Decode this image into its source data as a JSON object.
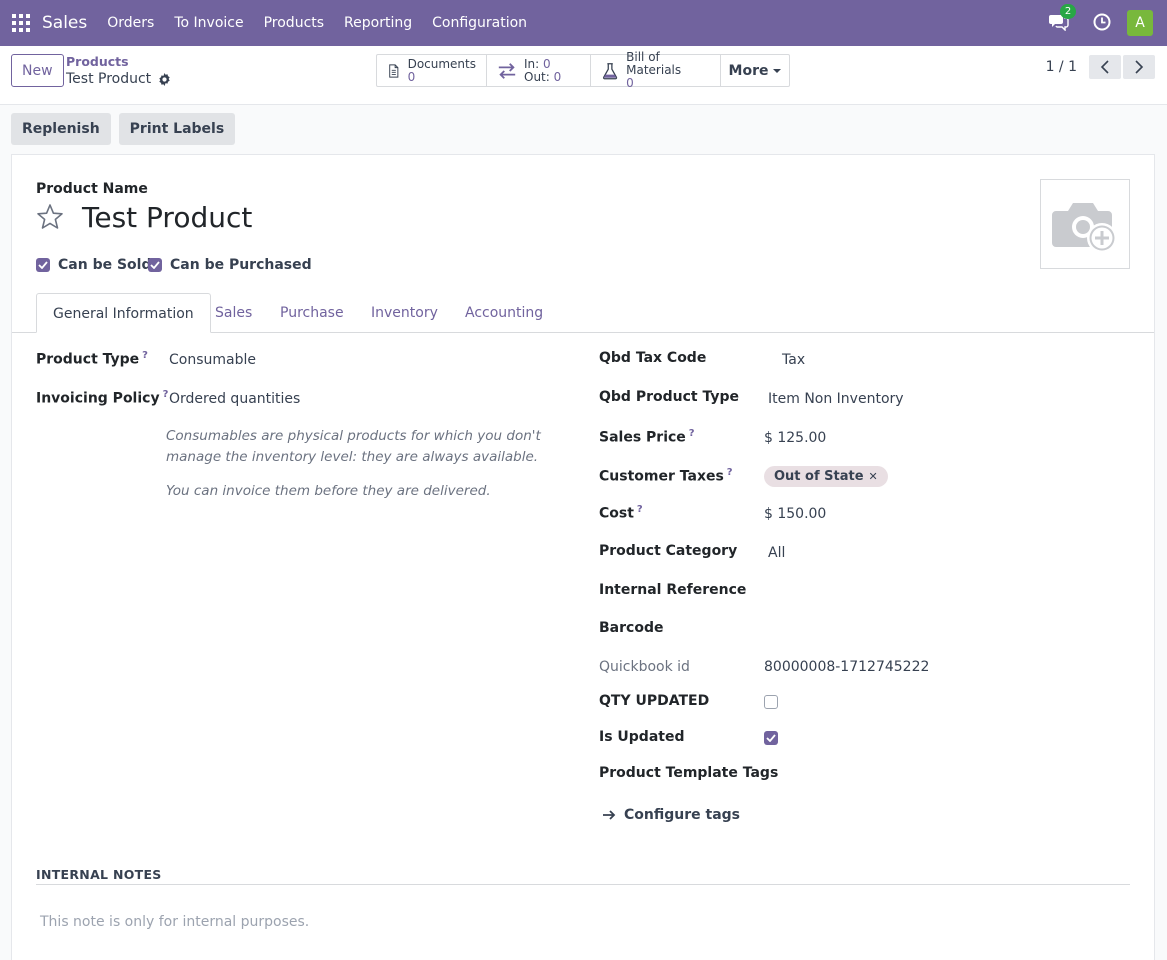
{
  "navbar": {
    "brand": "Sales",
    "menu": [
      "Orders",
      "To Invoice",
      "Products",
      "Reporting",
      "Configuration"
    ],
    "chat_badge": "2",
    "avatar_initial": "A",
    "color": "#71639e"
  },
  "control_panel": {
    "new_label": "New",
    "breadcrumb_parent": "Products",
    "breadcrumb_current": "Test Product",
    "smart_buttons": {
      "documents_label": "Documents",
      "documents_value": "0",
      "in_label": "In:",
      "in_value": "0",
      "out_label": "Out:",
      "out_value": "0",
      "bom_label": "Bill of Materials",
      "bom_value": "0",
      "more_label": "More"
    },
    "pager": "1 / 1"
  },
  "actions": {
    "replenish": "Replenish",
    "print_labels": "Print Labels"
  },
  "form": {
    "product_name_label": "Product Name",
    "product_name": "Test Product",
    "can_be_sold": "Can be Sold",
    "can_be_purchased": "Can be Purchased",
    "tabs": [
      "General Information",
      "Sales",
      "Purchase",
      "Inventory",
      "Accounting"
    ],
    "left": {
      "product_type_label": "Product Type",
      "product_type": "Consumable",
      "invoicing_policy_label": "Invoicing Policy",
      "invoicing_policy": "Ordered quantities",
      "help_1": "Consumables are physical products for which you don't manage the inventory level: they are always available.",
      "help_2": "You can invoice them before they are delivered."
    },
    "right": {
      "qbd_tax_code_label": "Qbd Tax Code",
      "qbd_tax_code": "Tax",
      "qbd_product_type_label": "Qbd Product Type",
      "qbd_product_type": "Item Non Inventory",
      "sales_price_label": "Sales Price",
      "sales_price": "$ 125.00",
      "customer_taxes_label": "Customer Taxes",
      "customer_tax_tag": "Out of State",
      "cost_label": "Cost",
      "cost": "$ 150.00",
      "product_category_label": "Product Category",
      "product_category": "All",
      "internal_reference_label": "Internal Reference",
      "barcode_label": "Barcode",
      "quickbook_id_label": "Quickbook id",
      "quickbook_id": "80000008-1712745222",
      "qty_updated_label": "QTY UPDATED",
      "is_updated_label": "Is Updated",
      "product_template_tags_label": "Product Template Tags",
      "configure_tags": "Configure tags"
    },
    "notes_title": "INTERNAL NOTES",
    "notes_placeholder": "This note is only for internal purposes."
  }
}
